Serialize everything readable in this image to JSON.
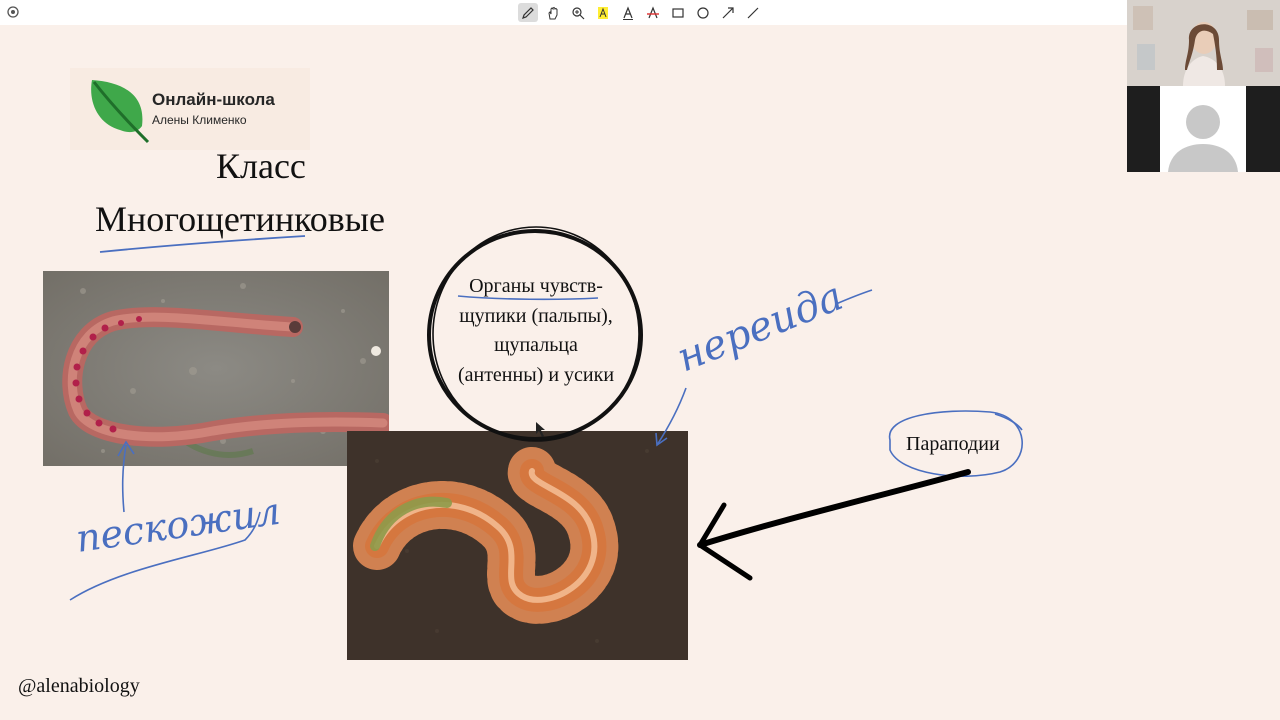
{
  "toolbar": {
    "tools": [
      {
        "name": "pen-tool",
        "icon": "pen-icon",
        "active": true
      },
      {
        "name": "hand-tool",
        "icon": "hand-icon",
        "active": false
      },
      {
        "name": "zoom-tool",
        "icon": "magnifier-plus-icon",
        "active": false
      },
      {
        "name": "highlighter-tool",
        "icon": "highlighter-icon",
        "active": false
      },
      {
        "name": "text-tool",
        "icon": "text-a-icon",
        "active": false
      },
      {
        "name": "strikethrough-tool",
        "icon": "strikethrough-a-icon",
        "active": false
      },
      {
        "name": "rectangle-tool",
        "icon": "rectangle-icon",
        "active": false
      },
      {
        "name": "ellipse-tool",
        "icon": "circle-icon",
        "active": false
      },
      {
        "name": "arrow-tool",
        "icon": "arrow-icon",
        "active": false
      },
      {
        "name": "line-tool",
        "icon": "line-icon",
        "active": false
      }
    ]
  },
  "logo": {
    "title": "Онлайн-школа",
    "subtitle": "Алены Клименко"
  },
  "slide": {
    "title_line1": "Класс",
    "title_line2": "Многощетинковые",
    "organs": [
      "Органы чувств-",
      "щупики (пальпы),",
      "щупальца",
      "(антенны) и  усики"
    ],
    "parapodii_label": "Параподии",
    "handle": "@alenabiology"
  },
  "annotations": {
    "handwritten_left": "пескожил",
    "handwritten_right": "нереида"
  },
  "colors": {
    "background": "#faf0ea",
    "ink_blue": "#4a6fc0",
    "logo_green": "#3aa04a"
  }
}
